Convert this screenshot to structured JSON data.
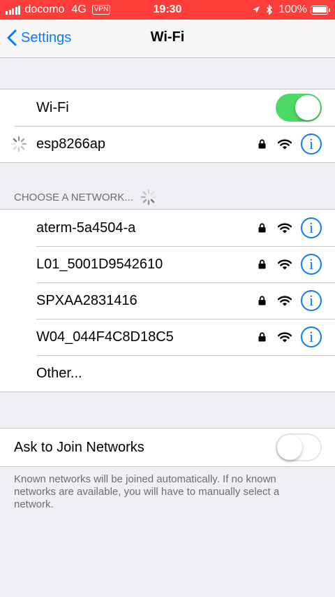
{
  "status_bar": {
    "carrier": "docomo",
    "network_type": "4G",
    "vpn": "VPN",
    "time": "19:30",
    "battery": "100%",
    "battery_level": 1.0,
    "icons": [
      "signal-icon",
      "location-arrow-icon",
      "bluetooth-icon",
      "battery-icon"
    ]
  },
  "nav": {
    "back_label": "Settings",
    "title": "Wi-Fi"
  },
  "wifi_toggle": {
    "label": "Wi-Fi",
    "state": "on"
  },
  "connecting_network": {
    "name": "esp8266ap",
    "secured": true
  },
  "choose_network": {
    "header": "CHOOSE A NETWORK...",
    "networks": [
      {
        "name": "aterm-5a4504-a",
        "secured": true
      },
      {
        "name": "L01_5001D9542610",
        "secured": true
      },
      {
        "name": "SPXAA2831416",
        "secured": true
      },
      {
        "name": "W04_044F4C8D18C5",
        "secured": true
      }
    ],
    "other_label": "Other..."
  },
  "ask_to_join": {
    "label": "Ask to Join Networks",
    "state": "off",
    "footer": "Known networks will be joined automatically. If no known networks are available, you will have to manually select a network."
  },
  "colors": {
    "status_bar_bg": "#fc3d39",
    "accent": "#0a7aff",
    "toggle_on": "#4cd964"
  }
}
